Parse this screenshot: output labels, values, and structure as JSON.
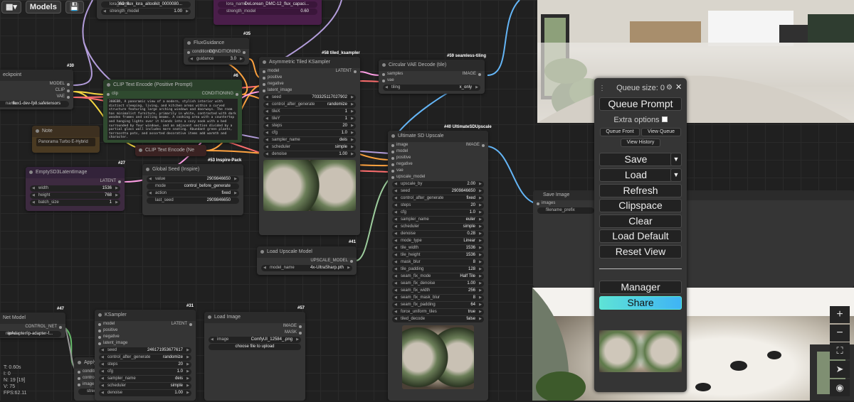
{
  "topbar": {
    "menu_icon": "▦▾",
    "models_label": "Models",
    "save_icon": "💾"
  },
  "lora": {
    "name_key": "lora_name",
    "name_value": "360_flux_lora_aitoolkit_0000080...",
    "strength_key": "strength_model",
    "strength_value": "1.00"
  },
  "lora2": {
    "name_key": "lora_name",
    "name_value": "DeLorean_DMC-12_flux_capaci...",
    "strength_key": "strength_model",
    "strength_value": "0.60"
  },
  "checkpoint": {
    "title": "eckpoint",
    "badge": "#30",
    "out_model": "MODEL",
    "out_clip": "CLIP",
    "out_vae": "VAE",
    "name_key": "name",
    "name_value": "flux1-dev-fp8.safetensors"
  },
  "flux_guidance": {
    "title": "FluxGuidance",
    "badge": "#35",
    "in_conditioning": "conditioning",
    "out_conditioning": "CONDITIONING",
    "guidance_key": "guidance",
    "guidance_value": "3.0"
  },
  "clip_pos": {
    "title": "CLIP Text Encode (Positive Prompt)",
    "badge": "#6",
    "in_clip": "clip",
    "out_conditioning": "CONDITIONING",
    "text": "360EBR, A panoramic view of a modern, stylish interior with distinct sleeping, living, and kitchen areas within a curved structure featuring large arching windows and doorways. The room has minimalist furniture, primarily in white, contrasted with dark wooden frames and ceiling beams. A cooking area with a countertop and hanging lights over it blends into a cozy nook with a bed surrounded by four windows, and an adjacent section divided by a partial glass wall includes more seating. Abundant green plants, terracotta pots, and assorted decorative items add warmth and character."
  },
  "note": {
    "title": "Note",
    "text": "Panorama Turbo E-Hybrid"
  },
  "clip_neg": {
    "title": "CLIP Text Encode (Ne"
  },
  "empty_latent": {
    "title": "EmptySD3LatentImage",
    "badge": "#27",
    "out_latent": "LATENT",
    "width_key": "width",
    "width_value": "1536",
    "height_key": "height",
    "height_value": "768",
    "batch_key": "batch_size",
    "batch_value": "1"
  },
  "global_seed": {
    "title": "Global Seed (Inspire)",
    "badge": "#53 Inspire-Pack",
    "value_key": "value",
    "value_value": "2909846650",
    "mode_key": "mode",
    "mode_value": "control_before_generate",
    "action_key": "action",
    "action_value": "fixed",
    "last_key": "last_seed",
    "last_value": "2909846650"
  },
  "ksampler58": {
    "title": "Asymmetric Tiled KSampler",
    "badge": "#58 tiled_ksampler",
    "inputs": [
      "model",
      "positive",
      "negative",
      "latent_image"
    ],
    "out_latent": "LATENT",
    "widgets": [
      [
        "seed",
        "703325117027902"
      ],
      [
        "control_after_generate",
        "randomize"
      ],
      [
        "tileX",
        "1"
      ],
      [
        "tileY",
        "1"
      ],
      [
        "steps",
        "20"
      ],
      [
        "cfg",
        "1.0"
      ],
      [
        "sampler_name",
        "deis"
      ],
      [
        "scheduler",
        "simple"
      ],
      [
        "denoise",
        "1.00"
      ]
    ]
  },
  "vae_decode": {
    "title": "Circular VAE Decode (tile)",
    "badge": "#59 seamless-tiling",
    "in_samples": "samples",
    "in_vae": "vae",
    "out_image": "IMAGE",
    "tiling_key": "tiling",
    "tiling_value": "x_only"
  },
  "upscale": {
    "title": "Ultimate SD Upscale",
    "badge": "#40 UltimateSDUpscale",
    "inputs": [
      "image",
      "model",
      "positive",
      "negative",
      "vae",
      "upscale_model"
    ],
    "out_image": "IMAGE",
    "widgets": [
      [
        "upscale_by",
        "2.00"
      ],
      [
        "seed",
        "2909846650"
      ],
      [
        "control_after_generate",
        "fixed"
      ],
      [
        "steps",
        "20"
      ],
      [
        "cfg",
        "1.0"
      ],
      [
        "sampler_name",
        "euler"
      ],
      [
        "scheduler",
        "simple"
      ],
      [
        "denoise",
        "0.28"
      ],
      [
        "mode_type",
        "Linear"
      ],
      [
        "tile_width",
        "1536"
      ],
      [
        "tile_height",
        "1536"
      ],
      [
        "mask_blur",
        "8"
      ],
      [
        "tile_padding",
        "128"
      ],
      [
        "seam_fix_mode",
        "Half Tile"
      ],
      [
        "seam_fix_denoise",
        "1.00"
      ],
      [
        "seam_fix_width",
        "256"
      ],
      [
        "seam_fix_mask_blur",
        "8"
      ],
      [
        "seam_fix_padding",
        "64"
      ],
      [
        "force_uniform_tiles",
        "true"
      ],
      [
        "tiled_decode",
        "false"
      ]
    ]
  },
  "load_upscale": {
    "title": "Load Upscale Model",
    "badge": "#41",
    "out": "UPSCALE_MODEL",
    "key": "model_name",
    "value": "4x-UltraSharp.pth"
  },
  "save_image": {
    "title": "Save Image",
    "in_images": "images",
    "prefix_key": "filename_prefix"
  },
  "controlnet": {
    "title": "Net Model",
    "badge": "#47",
    "out": "CONTROL_NET",
    "key": "name",
    "value": "ipAdapter/ip-adapter-f..."
  },
  "apply": {
    "title": "Apply",
    "inputs": [
      "conditi",
      "control_",
      "image"
    ],
    "widget": "strem"
  },
  "ksampler31": {
    "title": "KSampler",
    "badge": "#31",
    "inputs": [
      "model",
      "positive",
      "negative",
      "latent_image"
    ],
    "out_latent": "LATENT",
    "widgets": [
      [
        "seed",
        "246171953677617"
      ],
      [
        "control_after_generate",
        "randomize"
      ],
      [
        "steps",
        "20"
      ],
      [
        "cfg",
        "1.0"
      ],
      [
        "sampler_name",
        "deis"
      ],
      [
        "scheduler",
        "simple"
      ],
      [
        "denoise",
        "1.00"
      ]
    ]
  },
  "load_image": {
    "title": "Load Image",
    "badge": "#57",
    "out_image": "IMAGE",
    "out_mask": "MASK",
    "image_key": "image",
    "image_value": "ComfyUI_12584_.png",
    "upload": "choose file to upload"
  },
  "panel": {
    "queue_size": "Queue size: 0",
    "queue_prompt": "Queue Prompt",
    "extra_options": "Extra options",
    "queue_front": "Queue Front",
    "view_queue": "View Queue",
    "view_history": "View History",
    "save": "Save",
    "load": "Load",
    "refresh": "Refresh",
    "clipspace": "Clipspace",
    "clear": "Clear",
    "load_default": "Load Default",
    "reset_view": "Reset View",
    "manager": "Manager",
    "share": "Share"
  },
  "stats": {
    "t": "T: 0.60s",
    "i": "I: 0",
    "n": "N: 19 [19]",
    "v": "V: 75",
    "fps": "FPS:62.11"
  },
  "colors": {
    "share_gradient_start": "#5ee3d6",
    "share_gradient_end": "#3fb4f5",
    "wire_clip": "#f5d742",
    "wire_cond": "#ffa340",
    "wire_latent": "#ff9fe6",
    "wire_image": "#64b5f6",
    "wire_vae": "#ff6e6e",
    "wire_model": "#b39ddb"
  }
}
